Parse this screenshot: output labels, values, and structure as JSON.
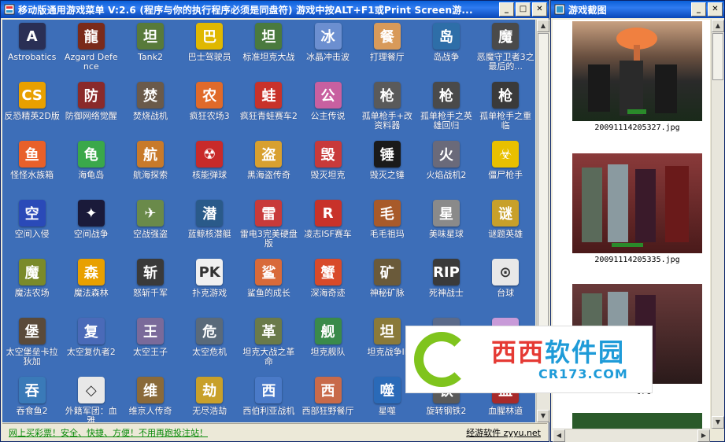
{
  "main_window": {
    "title": "移动版通用游戏菜单 V:2.6 (程序与你的执行程序必须是同盘符) 游戏中按ALT+F1或Print Screen游...",
    "min_label": "_",
    "max_label": "□",
    "close_label": "✕"
  },
  "games": [
    {
      "label": "Astrobatics",
      "icon": "astrobatics-icon",
      "color": "#2a2f55",
      "glyph": "A"
    },
    {
      "label": "Azgard Defence",
      "icon": "dragon-icon",
      "color": "#7a2a1a",
      "glyph": "龍"
    },
    {
      "label": "Tank2",
      "icon": "tank-icon",
      "color": "#587a3a",
      "glyph": "坦"
    },
    {
      "label": "巴士驾驶员",
      "icon": "bus-icon",
      "color": "#e0b800",
      "glyph": "巴"
    },
    {
      "label": "标准坦克大战",
      "icon": "tank-icon",
      "color": "#4a7a3e",
      "glyph": "坦"
    },
    {
      "label": "冰晶冲击波",
      "icon": "crystal-icon",
      "color": "#6c8fd0",
      "glyph": "冰"
    },
    {
      "label": "打理餐厅",
      "icon": "waiter-icon",
      "color": "#d89a5a",
      "glyph": "餐"
    },
    {
      "label": "岛战争",
      "icon": "island-icon",
      "color": "#2e6ea8",
      "glyph": "岛"
    },
    {
      "label": "恶魔守卫者3之最后的...",
      "icon": "demon-icon",
      "color": "#4a4a4a",
      "glyph": "魔"
    },
    {
      "label": "反恐精英2D版",
      "icon": "cs-icon",
      "color": "#e8a000",
      "glyph": "CS"
    },
    {
      "label": "防御网络觉醒",
      "icon": "network-icon",
      "color": "#8a2a2a",
      "glyph": "防"
    },
    {
      "label": "焚烧战机",
      "icon": "jet-icon",
      "color": "#6a5a4a",
      "glyph": "焚"
    },
    {
      "label": "疯狂农场3",
      "icon": "farm-icon",
      "color": "#e06a2a",
      "glyph": "农"
    },
    {
      "label": "疯狂青蛙赛车2",
      "icon": "frog-icon",
      "color": "#c8322a",
      "glyph": "蛙"
    },
    {
      "label": "公主传说",
      "icon": "princess-icon",
      "color": "#c860a0",
      "glyph": "公"
    },
    {
      "label": "孤单枪手+改资料器",
      "icon": "gun-icon",
      "color": "#5a5a5a",
      "glyph": "枪"
    },
    {
      "label": "孤单枪手之英雄回归",
      "icon": "gun-icon",
      "color": "#4a4a4a",
      "glyph": "枪"
    },
    {
      "label": "孤单枪手之重临",
      "icon": "gun-icon",
      "color": "#3a3a3a",
      "glyph": "枪"
    },
    {
      "label": "怪怪水族箱",
      "icon": "fish-icon",
      "color": "#e8602a",
      "glyph": "鱼"
    },
    {
      "label": "海龟岛",
      "icon": "turtle-icon",
      "color": "#3aa84a",
      "glyph": "龟"
    },
    {
      "label": "航海探索",
      "icon": "pirate-icon",
      "color": "#c87a2a",
      "glyph": "航"
    },
    {
      "label": "核能弹球",
      "icon": "nuclear-icon",
      "color": "#c82a2a",
      "glyph": "☢"
    },
    {
      "label": "黑海盗传奇",
      "icon": "pirate-ship-icon",
      "color": "#d8a030",
      "glyph": "盗"
    },
    {
      "label": "毁灭坦克",
      "icon": "tank-icon",
      "color": "#c83a3a",
      "glyph": "毁"
    },
    {
      "label": "毁灭之锤",
      "icon": "hammer-icon",
      "color": "#1a1a1a",
      "glyph": "锤"
    },
    {
      "label": "火焰战机2",
      "icon": "fighter-icon",
      "color": "#6a6a7a",
      "glyph": "火"
    },
    {
      "label": "僵尸枪手",
      "icon": "biohazard-icon",
      "color": "#e8c000",
      "glyph": "☣"
    },
    {
      "label": "空间入侵",
      "icon": "spaceship-icon",
      "color": "#2a4ab8",
      "glyph": "空"
    },
    {
      "label": "空间战争",
      "icon": "space-icon",
      "color": "#1a1a3a",
      "glyph": "✦"
    },
    {
      "label": "空战强盗",
      "icon": "plane-icon",
      "color": "#6a8a4a",
      "glyph": "✈"
    },
    {
      "label": "蓝鲸核潜艇",
      "icon": "submarine-icon",
      "color": "#2a5a8a",
      "glyph": "潜"
    },
    {
      "label": "雷电3完美硬盘版",
      "icon": "raiden-icon",
      "color": "#c83a3a",
      "glyph": "雷"
    },
    {
      "label": "凌志ISF赛车",
      "icon": "racing-icon",
      "color": "#c8322a",
      "glyph": "R"
    },
    {
      "label": "毛毛祖玛",
      "icon": "zuma-icon",
      "color": "#a85a2a",
      "glyph": "毛"
    },
    {
      "label": "美味星球",
      "icon": "planet-icon",
      "color": "#8a8a8a",
      "glyph": "星"
    },
    {
      "label": "谜题英雄",
      "icon": "helmet-icon",
      "color": "#c8a02a",
      "glyph": "谜"
    },
    {
      "label": "魔法农场",
      "icon": "farm-icon",
      "color": "#7a8a2a",
      "glyph": "魔"
    },
    {
      "label": "魔法森林",
      "icon": "magic-icon",
      "color": "#e8a000",
      "glyph": "森"
    },
    {
      "label": "怒斩千军",
      "icon": "sword-icon",
      "color": "#3a3a3a",
      "glyph": "斩"
    },
    {
      "label": "扑克游戏",
      "icon": "poker-icon",
      "color": "#f0f0f0",
      "glyph": "PK"
    },
    {
      "label": "鲨鱼的成长",
      "icon": "fish-icon",
      "color": "#d86a3a",
      "glyph": "鲨"
    },
    {
      "label": "深海奇迹",
      "icon": "crab-icon",
      "color": "#d84a2a",
      "glyph": "蟹"
    },
    {
      "label": "神秘矿脉",
      "icon": "mine-cart-icon",
      "color": "#6a5a3a",
      "glyph": "矿"
    },
    {
      "label": "死神战士",
      "icon": "rip-icon",
      "color": "#3a3a3a",
      "glyph": "RIP"
    },
    {
      "label": "台球",
      "icon": "billiard-icon",
      "color": "#e8e8e8",
      "glyph": "⊙"
    },
    {
      "label": "太空堡垒卡拉狄加",
      "icon": "space-station-icon",
      "color": "#5a4a3a",
      "glyph": "堡"
    },
    {
      "label": "太空复仇者2",
      "icon": "spaceship-icon",
      "color": "#4a6ab8",
      "glyph": "复"
    },
    {
      "label": "太空王子",
      "icon": "orb-icon",
      "color": "#7a6a9a",
      "glyph": "王"
    },
    {
      "label": "太空危机",
      "icon": "ship-icon",
      "color": "#5a6a7a",
      "glyph": "危"
    },
    {
      "label": "坦克大战之革命",
      "icon": "tank-icon",
      "color": "#6a7a4a",
      "glyph": "革"
    },
    {
      "label": "坦克舰队",
      "icon": "tank-icon",
      "color": "#3a8a4a",
      "glyph": "舰"
    },
    {
      "label": "坦克战争II",
      "icon": "tank-icon",
      "color": "#8a7a3a",
      "glyph": "坦"
    },
    {
      "label": "",
      "icon": "space-icon",
      "color": "#5a6a8a",
      "glyph": "◎"
    },
    {
      "label": "",
      "icon": "character-icon",
      "color": "#c89ad8",
      "glyph": "★"
    },
    {
      "label": "吞食鱼2",
      "icon": "fish-icon",
      "color": "#3a7ab8",
      "glyph": "吞"
    },
    {
      "label": "外籍军团：血雅",
      "icon": "unity-icon",
      "color": "#e8e8e8",
      "glyph": "◇"
    },
    {
      "label": "维京人传奇",
      "icon": "viking-icon",
      "color": "#8a6a3a",
      "glyph": "维"
    },
    {
      "label": "无尽浩劫",
      "icon": "swirl-icon",
      "color": "#c8a02a",
      "glyph": "劫"
    },
    {
      "label": "西伯利亚战机",
      "icon": "plane-icon",
      "color": "#4a7ac8",
      "glyph": "西"
    },
    {
      "label": "西部狂野餐厅",
      "icon": "cowgirl-icon",
      "color": "#c86a4a",
      "glyph": "西"
    },
    {
      "label": "星噬",
      "icon": "orb-icon",
      "color": "#2a6ab8",
      "glyph": "噬"
    },
    {
      "label": "旋转钢铁2",
      "icon": "gear-icon",
      "color": "#5a5a5a",
      "glyph": "铁"
    },
    {
      "label": "血腥林道",
      "icon": "blood-icon",
      "color": "#a82a2a",
      "glyph": "血"
    }
  ],
  "statusbar": {
    "left_link": "网上买彩票！安全、快捷、方便！不用再跑投注站！",
    "right_link": "经游软件 zyyu.net"
  },
  "shots_window": {
    "title": "游戏截图",
    "min_label": "_",
    "close_label": "✕",
    "shots": [
      {
        "caption": "20091114205327.jpg",
        "icon": "screenshot-thumb-icon"
      },
      {
        "caption": "20091114205335.jpg",
        "icon": "screenshot-thumb-icon"
      },
      {
        "caption": "39.jpg",
        "icon": "screenshot-thumb-icon"
      }
    ]
  },
  "watermark": {
    "big_text_red": "西西",
    "big_text_blue": "软件园",
    "small_text": "CR173.COM"
  },
  "colors": {
    "game_area_bg": "#3d6eb8",
    "titlebar": "#0a5fd8",
    "status_link": "#0a8a0a"
  }
}
